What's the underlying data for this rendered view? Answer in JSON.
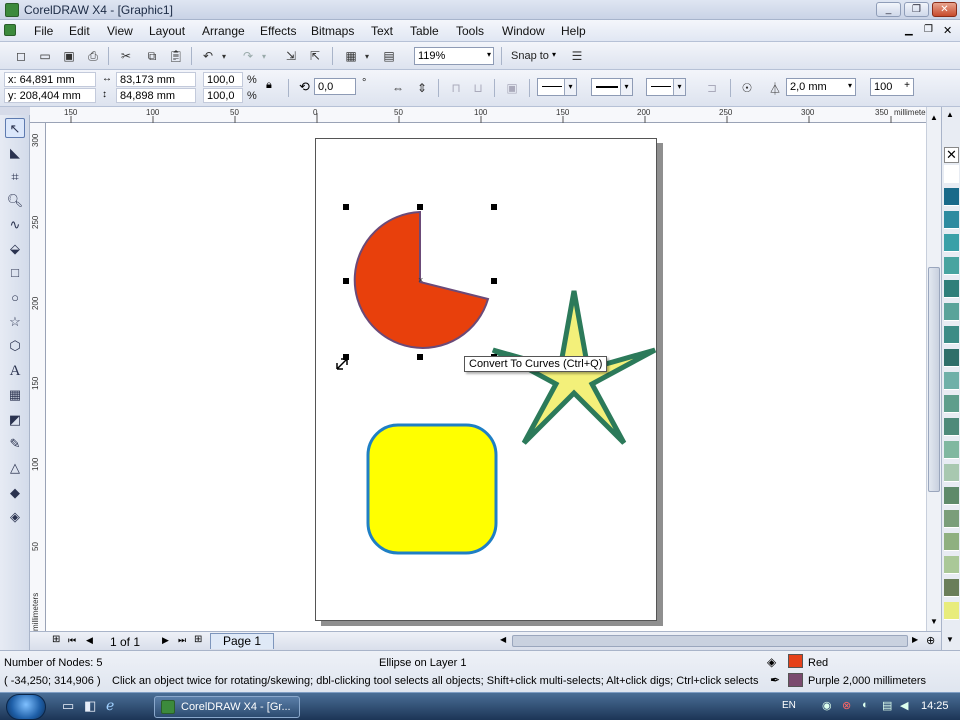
{
  "window": {
    "title": "CorelDRAW X4 - [Graphic1]",
    "minimize": "_",
    "restore": "❐",
    "close": "✕"
  },
  "menu": [
    "File",
    "Edit",
    "View",
    "Layout",
    "Arrange",
    "Effects",
    "Bitmaps",
    "Text",
    "Table",
    "Tools",
    "Window",
    "Help"
  ],
  "standard_toolbar": {
    "zoom_value": "119%",
    "snap_to_label": "Snap to"
  },
  "property_bar": {
    "x": "x: 64,891 mm",
    "y": "y: 208,404 mm",
    "width": "83,173 mm",
    "height": "84,898 mm",
    "scale_x": "100,0",
    "scale_y": "100,0",
    "percent": "%",
    "rotation": "0,0",
    "degree": "°",
    "outline_width": "2,0 mm",
    "extra_value": "100"
  },
  "ruler": {
    "unit": "millimeters",
    "h_ticks": [
      "150",
      "100",
      "50",
      "0",
      "50",
      "100",
      "150",
      "200",
      "250",
      "300",
      "350"
    ],
    "v_ticks": [
      "300",
      "250",
      "200",
      "150",
      "100",
      "50"
    ],
    "v_unit": "millimeters"
  },
  "tooltip": "Convert To Curves (Ctrl+Q)",
  "page_nav": {
    "counter": "1 of 1",
    "page_tab": "Page 1"
  },
  "status": {
    "nodes": "Number of Nodes: 5",
    "object": "Ellipse on Layer 1",
    "coords": "( -34,250; 314,906 )",
    "hint": "Click an object twice for rotating/skewing; dbl-clicking tool selects all objects; Shift+click multi-selects; Alt+click digs; Ctrl+click selects in a group",
    "fill_name": "Red",
    "outline_text": "Purple  2,000 millimeters",
    "fill_color": "#e5411a",
    "outline_color": "#7a4a6e"
  },
  "taskbar": {
    "task": "CorelDRAW X4 - [Gr...",
    "lang": "EN",
    "time": "14:25"
  },
  "colors": {
    "pie_fill": "#e8400c",
    "pie_stroke": "#6b4a78",
    "star_fill": "#f3f07a",
    "star_stroke": "#2c7a5a",
    "rect_fill": "#ffff00",
    "rect_stroke": "#1f7fc4"
  },
  "palette": [
    "#ffffff",
    "#1a6a8a",
    "#2e8ba0",
    "#3aa0a8",
    "#48a4a0",
    "#2f7f7a",
    "#5aa39a",
    "#3d8c86",
    "#2f6f6a",
    "#6fb0a8",
    "#5e9e8c",
    "#4e8a7a",
    "#80b8a0",
    "#a8c8b0",
    "#5e8a6a",
    "#7a9e7a",
    "#8fb080",
    "#aac898",
    "#6a7e5a",
    "#e8ec7c"
  ]
}
